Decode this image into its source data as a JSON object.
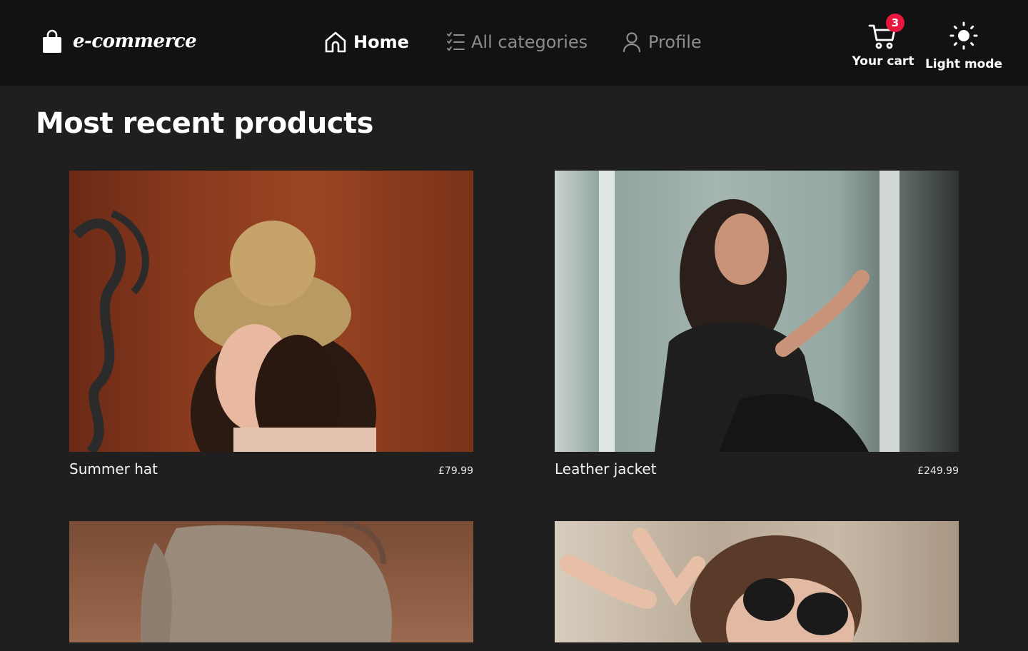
{
  "header": {
    "brand": "e-commerce",
    "nav": [
      {
        "label": "Home",
        "icon": "home-icon",
        "active": true
      },
      {
        "label": "All categories",
        "icon": "list-icon",
        "active": false
      },
      {
        "label": "Profile",
        "icon": "user-icon",
        "active": false
      }
    ],
    "cart": {
      "label": "Your cart",
      "count": "3"
    },
    "mode": {
      "label": "Light mode"
    }
  },
  "main": {
    "title": "Most recent products",
    "products": [
      {
        "name": "Summer hat",
        "price": "£79.99"
      },
      {
        "name": "Leather jacket",
        "price": "£249.99"
      },
      {
        "name": "",
        "price": ""
      },
      {
        "name": "",
        "price": ""
      }
    ]
  },
  "colors": {
    "header_bg": "#121212",
    "page_bg": "#1f1f20",
    "badge": "#e8173d",
    "nav_inactive": "#8d8d8f"
  }
}
